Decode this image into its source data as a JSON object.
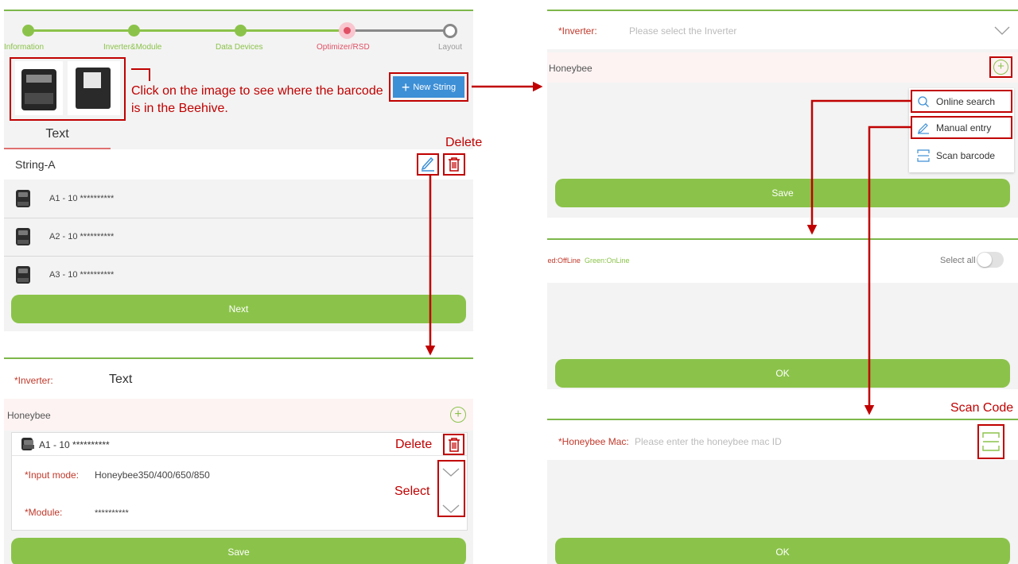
{
  "stepper": {
    "steps": [
      "Information",
      "Inverter&Module",
      "Data Devices",
      "Optimizer/RSD",
      "Layout"
    ]
  },
  "left": {
    "tip": "Click on the image to see where the barcode is in the Beehive.",
    "new_string_label": "New String",
    "tab_label": "Text",
    "string_name": "String-A",
    "rows": [
      "A1 - 10 **********",
      "A2 - 10 **********",
      "A3 - 10 **********"
    ],
    "next_label": "Next"
  },
  "bottom_left": {
    "inverter_label": "*Inverter:",
    "inverter_value": "Text",
    "honeybee_label": "Honeybee",
    "item_title": "A1 - 10 **********",
    "input_mode_label": "*Input mode:",
    "input_mode_value": "Honeybee350/400/650/850",
    "module_label": "*Module:",
    "module_value": "**********",
    "save_label": "Save"
  },
  "right_top": {
    "inverter_label": "*Inverter:",
    "inverter_placeholder": "Please select the Inverter",
    "honeybee_label": "Honeybee",
    "menu": [
      "Online search",
      "Manual entry",
      "Scan barcode"
    ],
    "save_label": "Save"
  },
  "right_mid": {
    "red_legend": "Red:OffLine",
    "green_legend": "Green:OnLine",
    "select_all_label": "Select all",
    "ok_label": "OK"
  },
  "right_bottom": {
    "mac_label": "*Honeybee Mac:",
    "mac_placeholder": "Please enter the honeybee mac ID",
    "ok_label": "OK"
  },
  "annotations": {
    "delete_top": "Delete",
    "delete_bottom": "Delete",
    "select": "Select",
    "scan_code": "Scan Code"
  },
  "colors": {
    "accent_green": "#8bc34a",
    "annotation_red": "#c00000",
    "button_blue": "#3d8fd6"
  }
}
